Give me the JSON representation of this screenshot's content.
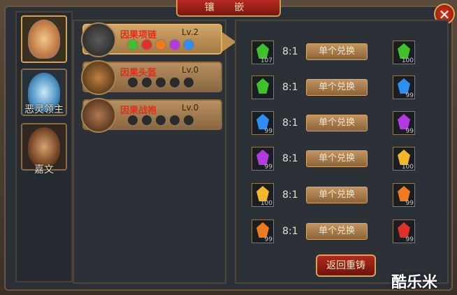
{
  "window": {
    "title": "镶 嵌",
    "close_symbol": "✕"
  },
  "heroes": [
    {
      "name": ""
    },
    {
      "name": "恶灵领主"
    },
    {
      "name": "嘉文"
    }
  ],
  "equipment": [
    {
      "name": "因果项链",
      "level": "Lv.2",
      "slots": [
        "green",
        "red",
        "orange",
        "purple",
        "blue"
      ]
    },
    {
      "name": "因果头盔",
      "level": "Lv.0",
      "slots": [
        "empty",
        "empty",
        "empty",
        "empty",
        "empty"
      ]
    },
    {
      "name": "因果战袍",
      "level": "Lv.0",
      "slots": [
        "empty",
        "empty",
        "empty",
        "empty",
        "empty"
      ]
    }
  ],
  "exchanges": [
    {
      "from_color": "#3fc12a",
      "from_count": "107",
      "ratio": "8:1",
      "button": "单个兑换",
      "to_color": "#3fc12a",
      "to_count": "100"
    },
    {
      "from_color": "#3fc12a",
      "from_count": "",
      "ratio": "8:1",
      "button": "单个兑换",
      "to_color": "#2f8ef0",
      "to_count": "99"
    },
    {
      "from_color": "#2f8ef0",
      "from_count": "99",
      "ratio": "8:1",
      "button": "单个兑换",
      "to_color": "#b33ae0",
      "to_count": "99"
    },
    {
      "from_color": "#b33ae0",
      "from_count": "99",
      "ratio": "8:1",
      "button": "单个兑换",
      "to_color": "#f0b82a",
      "to_count": "100"
    },
    {
      "from_color": "#f0b82a",
      "from_count": "100",
      "ratio": "8:1",
      "button": "单个兑换",
      "to_color": "#f07a1e",
      "to_count": "99"
    },
    {
      "from_color": "#f07a1e",
      "from_count": "99",
      "ratio": "8:1",
      "button": "单个兑换",
      "to_color": "#e0302a",
      "to_count": "99"
    }
  ],
  "return_button": "返回重铸",
  "watermark": "酷乐米",
  "colors": {
    "slot_green": "#3fc12a",
    "slot_red": "#e0302a",
    "slot_orange": "#f07a1e",
    "slot_purple": "#b33ae0",
    "slot_blue": "#2f8ef0"
  }
}
